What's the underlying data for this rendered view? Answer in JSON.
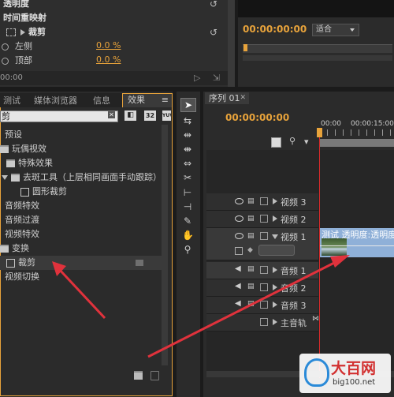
{
  "effect_controls": {
    "opacity_label": "透明度",
    "time_remap_label": "时间重映射",
    "crop_label": "裁剪",
    "left_label": "左侧",
    "left_value": "0.0 %",
    "top_label": "顶部",
    "top_value": "0.0 %",
    "bottom_time": "00:00"
  },
  "program_monitor": {
    "timecode": "00:00:00:00",
    "fit_label": "适合"
  },
  "project_tabs": [
    "测试",
    "媒体浏览器",
    "信息",
    "效果"
  ],
  "search": {
    "value": "剪"
  },
  "search_buttons": [
    "32",
    "YUV"
  ],
  "effects_tree": [
    "预设",
    "玩偶视效",
    "特殊效果",
    "去斑工具（上层相同画面手动跟踪）",
    "圆形裁剪",
    "音频特效",
    "音频过渡",
    "视频特效",
    "变换",
    "裁剪",
    "视频切换"
  ],
  "timeline": {
    "tab_label": "序列 01",
    "timecode": "00:00:00:00",
    "ruler_labels": [
      "00:00",
      "00:00:15:00"
    ],
    "video_tracks": [
      "视频 3",
      "视频 2",
      "视频 1"
    ],
    "audio_tracks": [
      "音频 1",
      "音频 2",
      "音频 3"
    ],
    "master_track": "主音轨",
    "clip_label": "测试 透明度:透明度"
  },
  "watermark": {
    "brand": "大百网",
    "url": "big100.net"
  },
  "colors": {
    "accent": "#e8a33b",
    "arrow": "#e0323c",
    "playhead": "#d42a2a",
    "clip": "#8fb0d8"
  }
}
